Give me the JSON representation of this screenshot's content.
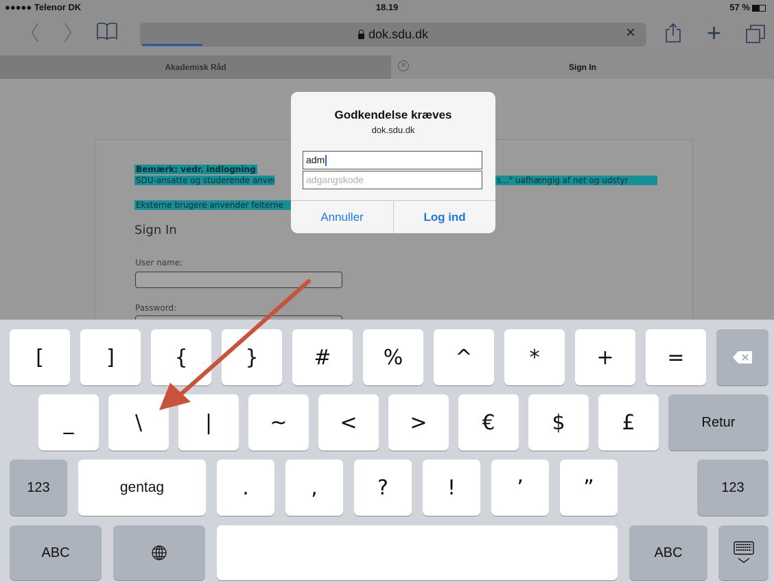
{
  "status": {
    "carrier": "●●●●● Telenor DK",
    "time": "18.19",
    "battery": "57 %"
  },
  "toolbar": {
    "url": "dok.sdu.dk",
    "back_glyph": "〈",
    "forward_glyph": "〉",
    "clear_glyph": "×",
    "new_tab_glyph": "+"
  },
  "tabs": [
    {
      "label": "Akademisk Råd"
    },
    {
      "label": "Sign In"
    }
  ],
  "page": {
    "notice_title": "Bemærk: vedr. indlogning",
    "notice_line1_start": "SDU-ansatte og studerende anvend",
    "notice_line1_end": "s...\" uafhængig af net og udstyr",
    "notice_line2": "Eksterne brugere anvender felterne",
    "heading": "Sign In",
    "username_label": "User name:",
    "password_label": "Password:"
  },
  "dialog": {
    "title": "Godkendelse kræves",
    "host": "dok.sdu.dk",
    "username_value": "adm",
    "password_placeholder": "adgangskode",
    "cancel_label": "Annuller",
    "login_label": "Log ind"
  },
  "keyboard": {
    "row1": [
      "[",
      "]",
      "{",
      "}",
      "#",
      "%",
      "^",
      "*",
      "+",
      "="
    ],
    "row2": [
      "_",
      "\\",
      "|",
      "~",
      "<",
      ">",
      "€",
      "$",
      "£"
    ],
    "row3": [
      ".",
      ",",
      "?",
      "!",
      "’",
      "”"
    ],
    "return_label": "Retur",
    "num_label": "123",
    "undo_label": "gentag",
    "abc_label": "ABC"
  },
  "colors": {
    "link_blue": "#1d79e6",
    "highlight": "#168f96",
    "arrow": "#c8523a"
  }
}
